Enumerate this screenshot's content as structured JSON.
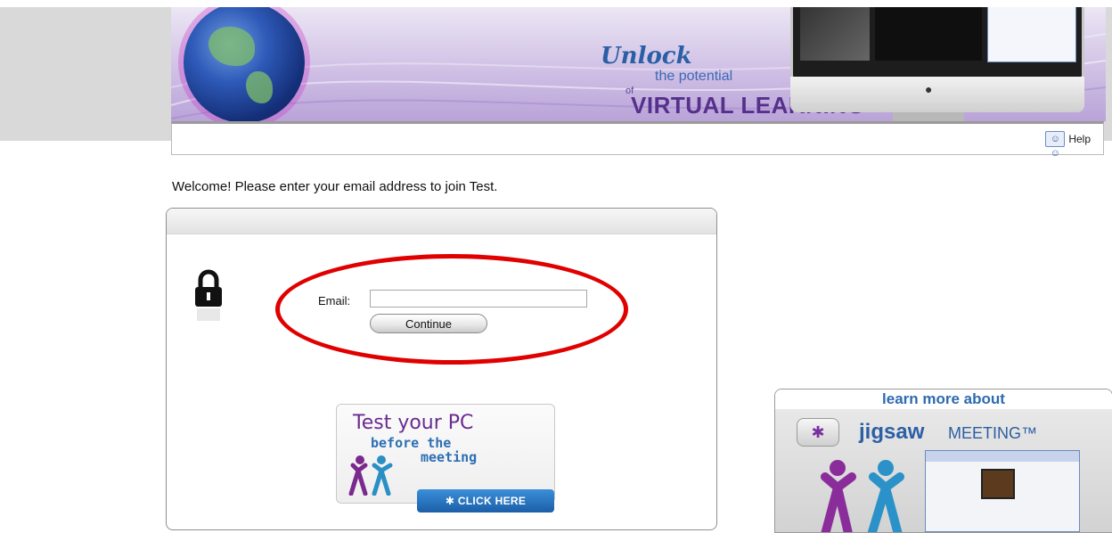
{
  "banner": {
    "headline_unlock": "Unlock",
    "headline_potential": "the potential",
    "headline_of": "of",
    "headline_virtual": "VIRTUAL LEARNING"
  },
  "help": {
    "label": "Help",
    "icon": "help-people-icon"
  },
  "welcome_text": "Welcome! Please enter your email address to join Test.",
  "login": {
    "email_label": "Email:",
    "email_value": "",
    "continue_label": "Continue",
    "lock_icon": "padlock-icon"
  },
  "test_pc": {
    "title": "Test your PC",
    "subtitle1": "before the",
    "subtitle2": "meeting",
    "button_label": "✱ CLICK HERE"
  },
  "learn_more": {
    "header": "learn more about",
    "brand": "jigsaw",
    "product": "MEETING™"
  },
  "colors": {
    "annotation_ellipse": "#e00000",
    "brand_blue": "#2c5fa3",
    "brand_purple": "#6a2b8f"
  }
}
